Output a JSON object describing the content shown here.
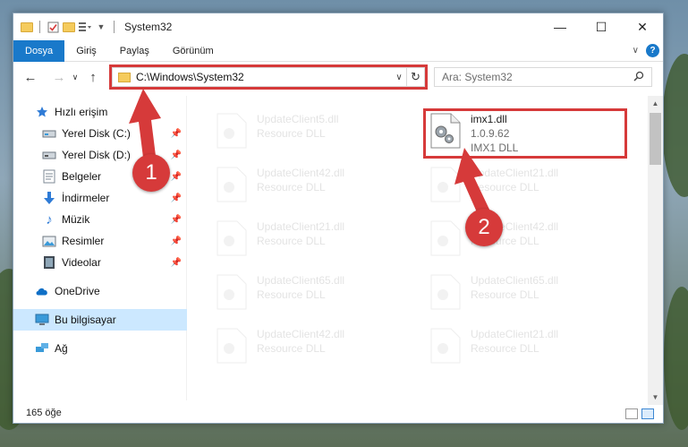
{
  "window": {
    "title": "System32",
    "minimize": "—",
    "maximize": "☐",
    "close": "✕"
  },
  "ribbon": {
    "tabs": [
      {
        "label": "Dosya",
        "active": true
      },
      {
        "label": "Giriş"
      },
      {
        "label": "Paylaş"
      },
      {
        "label": "Görünüm"
      }
    ],
    "help": "?"
  },
  "navigation": {
    "address": "C:\\Windows\\System32",
    "search_placeholder": "Ara: System32"
  },
  "sidebar": {
    "items": [
      {
        "label": "Hızlı erişim",
        "icon": "star-icon",
        "pinned": false
      },
      {
        "label": "Yerel Disk (C:)",
        "icon": "drive-icon",
        "pinned": true
      },
      {
        "label": "Yerel Disk (D:)",
        "icon": "drive-icon",
        "pinned": true
      },
      {
        "label": "Belgeler",
        "icon": "documents-icon",
        "pinned": true
      },
      {
        "label": "İndirmeler",
        "icon": "download-icon",
        "pinned": true
      },
      {
        "label": "Müzik",
        "icon": "music-icon",
        "pinned": true
      },
      {
        "label": "Resimler",
        "icon": "pictures-icon",
        "pinned": true
      },
      {
        "label": "Videolar",
        "icon": "videos-icon",
        "pinned": true
      },
      {
        "label": "OneDrive",
        "icon": "cloud-icon",
        "pinned": false
      },
      {
        "label": "Bu bilgisayar",
        "icon": "computer-icon",
        "pinned": false,
        "selected": true
      },
      {
        "label": "Ağ",
        "icon": "network-icon",
        "pinned": false
      }
    ]
  },
  "files": {
    "highlighted": {
      "name": "imx1.dll",
      "version": "1.0.9.62",
      "description": "IMX1 DLL"
    },
    "background": [
      {
        "name": "UpdateClient5.dll",
        "type": "Resource DLL"
      },
      {
        "name": "UpdateClient42.dll",
        "type": "Resource DLL"
      },
      {
        "name": "UpdateClient21.dll",
        "type": "Resource DLL"
      },
      {
        "name": "UpdateClient21.dll",
        "type": "Resource DLL"
      },
      {
        "name": "UpdateClient42.dll",
        "type": "Resource DLL"
      },
      {
        "name": "UpdateClient65.dll",
        "type": "Resource DLL"
      },
      {
        "name": "UpdateClient65.dll",
        "type": "Resource DLL"
      },
      {
        "name": "UpdateClient42.dll",
        "type": "Resource DLL"
      },
      {
        "name": "UpdateClient21.dll",
        "type": "Resource DLL"
      }
    ]
  },
  "status": {
    "count": "165 öğe"
  },
  "annotations": {
    "step1": "1",
    "step2": "2",
    "color": "#d63a3a"
  }
}
